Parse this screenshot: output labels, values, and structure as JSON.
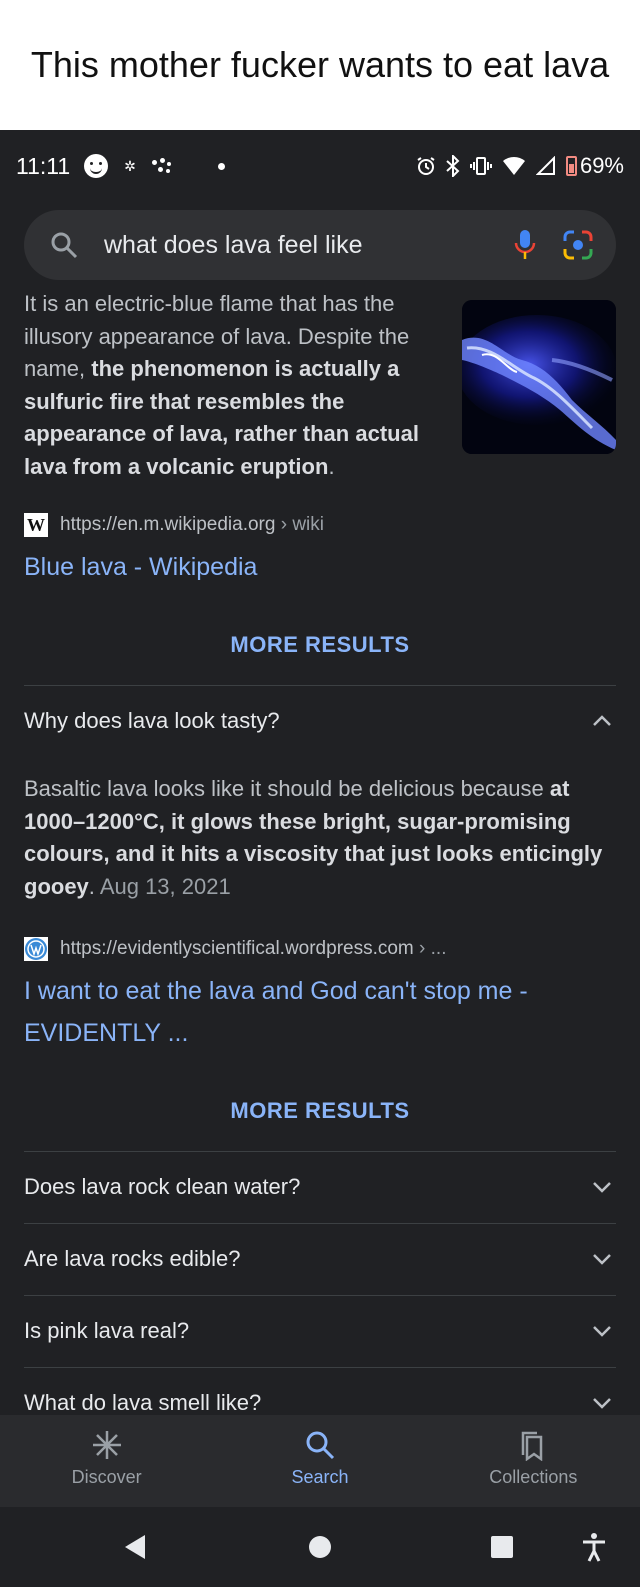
{
  "caption": "This mother fucker wants to eat lava",
  "status_bar": {
    "time": "11:11",
    "battery": "69%"
  },
  "search": {
    "query": "what does lava feel like"
  },
  "result1": {
    "snippet_plain_1": "It is an electric-blue flame that has the illusory appearance of lava. Despite the name, ",
    "snippet_bold": "the phenomenon is actually a sulfuric fire that resembles the appearance of lava, rather than actual lava from a volcanic eruption",
    "snippet_plain_2": ".",
    "source_url": "https://en.m.wikipedia.org",
    "source_path": " › wiki",
    "title": "Blue lava - Wikipedia",
    "more": "MORE RESULTS"
  },
  "faq_open": {
    "question": "Why does lava look tasty?",
    "answer_plain_1": "Basaltic lava looks like it should be delicious because ",
    "answer_bold": "at 1000–1200°C, it glows these bright, sugar-promising colours, and it hits a viscosity that just looks enticingly gooey",
    "answer_plain_2": ". ",
    "date": "Aug 13, 2021",
    "source_url": "https://evidentlyscientifical.wordpress.com",
    "source_path": " › ...",
    "title": "I want to eat the lava and God can't stop me - EVIDENTLY ...",
    "more": "MORE RESULTS"
  },
  "faq": [
    {
      "question": "Does lava rock clean water?"
    },
    {
      "question": "Are lava rocks edible?"
    },
    {
      "question": "Is pink lava real?"
    },
    {
      "question": "What do lava smell like?"
    }
  ],
  "bottom_nav": {
    "discover": "Discover",
    "search": "Search",
    "collections": "Collections"
  },
  "colors": {
    "background": "#202124",
    "link": "#8ab4f8",
    "text": "#bdc1c6"
  }
}
